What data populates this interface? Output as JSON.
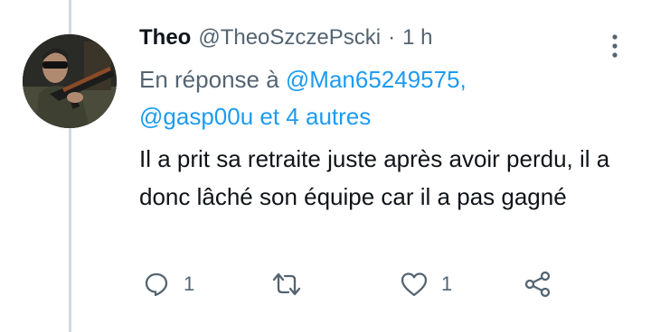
{
  "tweet": {
    "author_name": "Theo",
    "author_handle": "@TheoSzczePscki",
    "separator": "·",
    "timestamp": "1 h",
    "reply_prefix": "En réponse à",
    "reply_mention_1": "@Man65249575,",
    "reply_mention_2": "@gasp00u",
    "reply_others": "et 4 autres",
    "text": "Il a prit sa retraite juste après avoir perdu, il a donc lâché son équipe car il a pas gagné"
  },
  "actions": {
    "reply_count": "1",
    "retweet_count": "",
    "like_count": "1"
  },
  "icons": {
    "more": "more-vertical-icon",
    "reply": "reply-icon",
    "retweet": "retweet-icon",
    "like": "heart-icon",
    "share": "share-icon"
  },
  "colors": {
    "link": "#1d9bf0",
    "secondary_text": "#536471",
    "primary_text": "#0f1419",
    "thread_line": "#cfd9de"
  }
}
